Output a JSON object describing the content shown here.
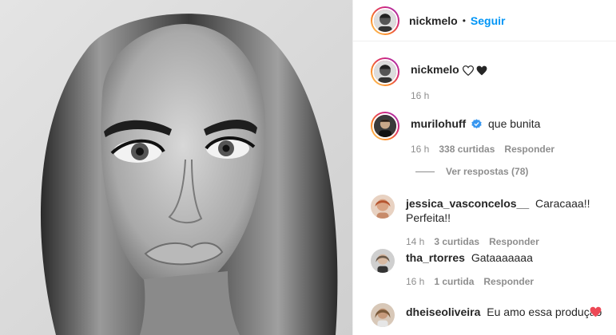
{
  "post": {
    "author": "nickmelo",
    "follow_label": "Seguir",
    "separator": "•"
  },
  "caption": {
    "author": "nickmelo",
    "time": "16 h"
  },
  "comments": [
    {
      "author": "murilohuff",
      "text": "que bunita",
      "time": "16 h",
      "likes": "338 curtidas",
      "reply_label": "Responder",
      "verified": true,
      "view_replies": "Ver respostas (78)"
    },
    {
      "author": "jessica_vasconcelos__",
      "text": "Caracaaa!! Perfeita!!",
      "time": "14 h",
      "likes": "3 curtidas",
      "reply_label": "Responder"
    },
    {
      "author": "tha_rtorres",
      "text": "Gataaaaaaa",
      "time": "16 h",
      "likes": "1 curtida",
      "reply_label": "Responder"
    },
    {
      "author": "dheiseoliveira",
      "text": "Eu amo essa produção"
    }
  ],
  "colors": {
    "link_blue": "#0095f6",
    "verified_blue": "#3897f0",
    "heart_red": "#ed4956",
    "muted_gray": "#8e8e8e"
  },
  "icons": {
    "caption_hearts": [
      "heart-outline-icon",
      "heart-filled-black-icon"
    ],
    "verified": "verified-badge-icon",
    "comment_heart": "heart-red-icon"
  }
}
